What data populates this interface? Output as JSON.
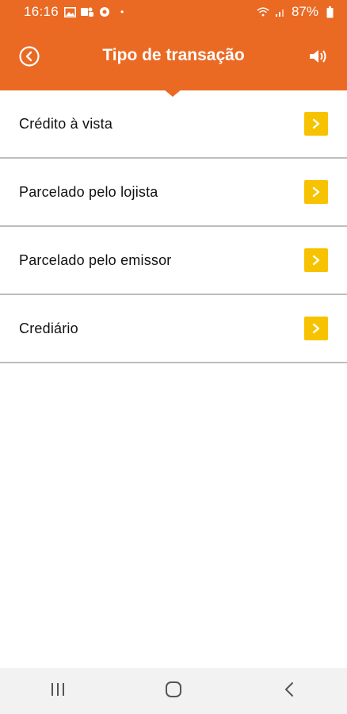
{
  "status_bar": {
    "time": "16:16",
    "battery": "87%",
    "dot": "•"
  },
  "header": {
    "title": "Tipo de transação"
  },
  "list": {
    "items": [
      {
        "label": "Crédito à vista"
      },
      {
        "label": "Parcelado pelo lojista"
      },
      {
        "label": "Parcelado pelo emissor"
      },
      {
        "label": "Crediário"
      }
    ]
  },
  "icons": {
    "back": "back-circle-icon",
    "sound": "speaker-icon",
    "chevron": "chevron-right-icon"
  },
  "colors": {
    "primary": "#ea6a24",
    "accent": "#f7c300",
    "divider": "#bdbdbd"
  }
}
